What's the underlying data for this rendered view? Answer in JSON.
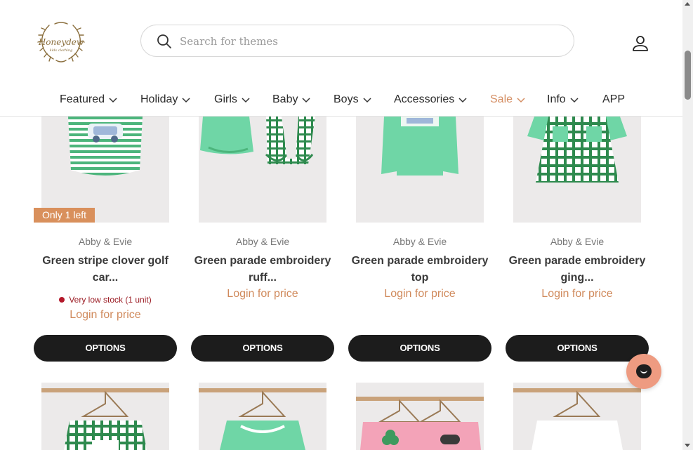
{
  "brand": {
    "logo_text": "Honeydew",
    "logo_subtext": "kids clothing"
  },
  "search": {
    "placeholder": "Search for themes",
    "value": ""
  },
  "nav": [
    {
      "label": "Featured",
      "dropdown": true
    },
    {
      "label": "Holiday",
      "dropdown": true
    },
    {
      "label": "Girls",
      "dropdown": true
    },
    {
      "label": "Baby",
      "dropdown": true
    },
    {
      "label": "Boys",
      "dropdown": true
    },
    {
      "label": "Accessories",
      "dropdown": true
    },
    {
      "label": "Sale",
      "dropdown": true,
      "highlight": true
    },
    {
      "label": "Info",
      "dropdown": true
    },
    {
      "label": "APP",
      "dropdown": false
    }
  ],
  "products": [
    {
      "badge": "Only 1 left",
      "vendor": "Abby & Evie",
      "title_line1": "Green stripe clover golf",
      "title_line2": "car...",
      "stock": "Very low stock (1 unit)",
      "price": "Login for price",
      "button": "OPTIONS"
    },
    {
      "vendor": "Abby & Evie",
      "title_line1": "Green parade embroidery",
      "title_line2": "ruff...",
      "price": "Login for price",
      "button": "OPTIONS"
    },
    {
      "vendor": "Abby & Evie",
      "title_line1": "Green parade embroidery",
      "title_line2": "top",
      "price": "Login for price",
      "button": "OPTIONS"
    },
    {
      "vendor": "Abby & Evie",
      "title_line1": "Green parade embroidery",
      "title_line2": "ging...",
      "price": "Login for price",
      "button": "OPTIONS"
    }
  ],
  "colors": {
    "accent": "#d08a5c",
    "button_bg": "#1c1c1c",
    "stock_red": "#b3182a",
    "chat_bg": "#ee9b81",
    "mint": "#6fd6a6",
    "gingham": "#2e8a4e",
    "pink": "#f3a3b8"
  },
  "icons": {
    "search": "search-icon",
    "account": "user-icon",
    "chevron": "chevron-down-icon",
    "chat": "chat-icon"
  }
}
